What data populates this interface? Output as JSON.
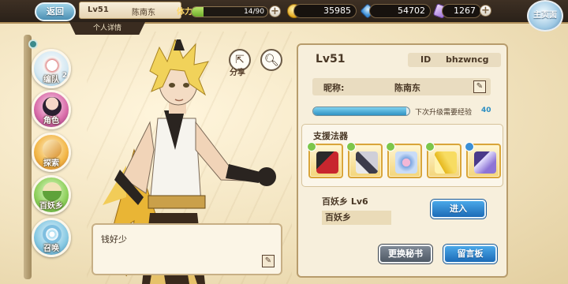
{
  "topbar": {
    "back_label": "返回",
    "player_level": "Lv51",
    "player_name": "陈南东",
    "profile_tab": "个人详情",
    "stamina_label": "体力",
    "stamina_text": "14/90",
    "stamina_fraction": 0.156,
    "gold": "35985",
    "gems": "54702",
    "crystals": "1267",
    "main_label": "主页面"
  },
  "nav": [
    {
      "label": "编队",
      "badge": "2"
    },
    {
      "label": "角色"
    },
    {
      "label": "探索"
    },
    {
      "label": "百妖乡"
    },
    {
      "label": "召唤"
    }
  ],
  "character": {
    "share_label": "分享",
    "speech": "钱好少"
  },
  "panel": {
    "level": "Lv51",
    "id_key": "ID",
    "id_value": "bhzwncg",
    "nickname_key": "昵称:",
    "nickname_value": "陈南东",
    "exp_label": "下次升级需要经验",
    "exp_value": "40",
    "exp_fraction": 0.97,
    "support_title": "支援法器",
    "artifacts": [
      {
        "name": "red-fan-artifact",
        "gem": "#7cc64a"
      },
      {
        "name": "dark-blade-artifact",
        "gem": "#7cc64a"
      },
      {
        "name": "blue-flower-artifact",
        "gem": "#7cc64a"
      },
      {
        "name": "golden-bird-artifact",
        "gem": "#7cc64a"
      },
      {
        "name": "purple-crystal-artifact",
        "gem": "#3a8fd6"
      }
    ],
    "town_line": "百妖乡 Lv6",
    "town_tag": "百妖乡",
    "enter_label": "进入",
    "change_secretary_label": "更换秘书",
    "message_board_label": "留言板"
  }
}
